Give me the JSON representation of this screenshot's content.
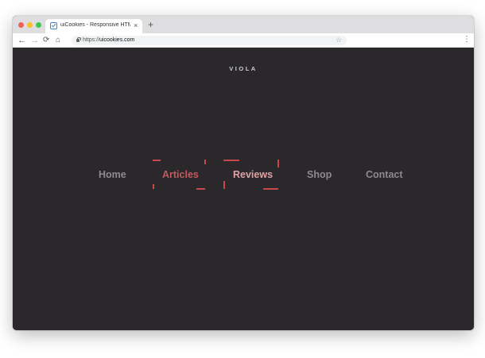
{
  "browser": {
    "tab_title": "uiCookies - Responsive HTML",
    "tab_close": "×",
    "new_tab": "+",
    "url_scheme": "https://",
    "url_host": "uicookies.com"
  },
  "icons": {
    "back": "arrow-left-icon",
    "forward": "arrow-right-icon",
    "reload": "reload-icon",
    "home": "home-icon",
    "lock": "lock-icon",
    "bookmark": "star-icon",
    "menu": "kebab-menu-icon"
  },
  "site": {
    "brand": "VIOLA",
    "nav": [
      {
        "label": "Home"
      },
      {
        "label": "Articles"
      },
      {
        "label": "Reviews"
      },
      {
        "label": "Shop"
      },
      {
        "label": "Contact"
      }
    ]
  },
  "colors": {
    "background": "#2a282b",
    "nav_text": "#8c8a8d",
    "accent": "#c9464a",
    "active_text": "#c45a5e",
    "hover_text": "#e0a2a4"
  }
}
